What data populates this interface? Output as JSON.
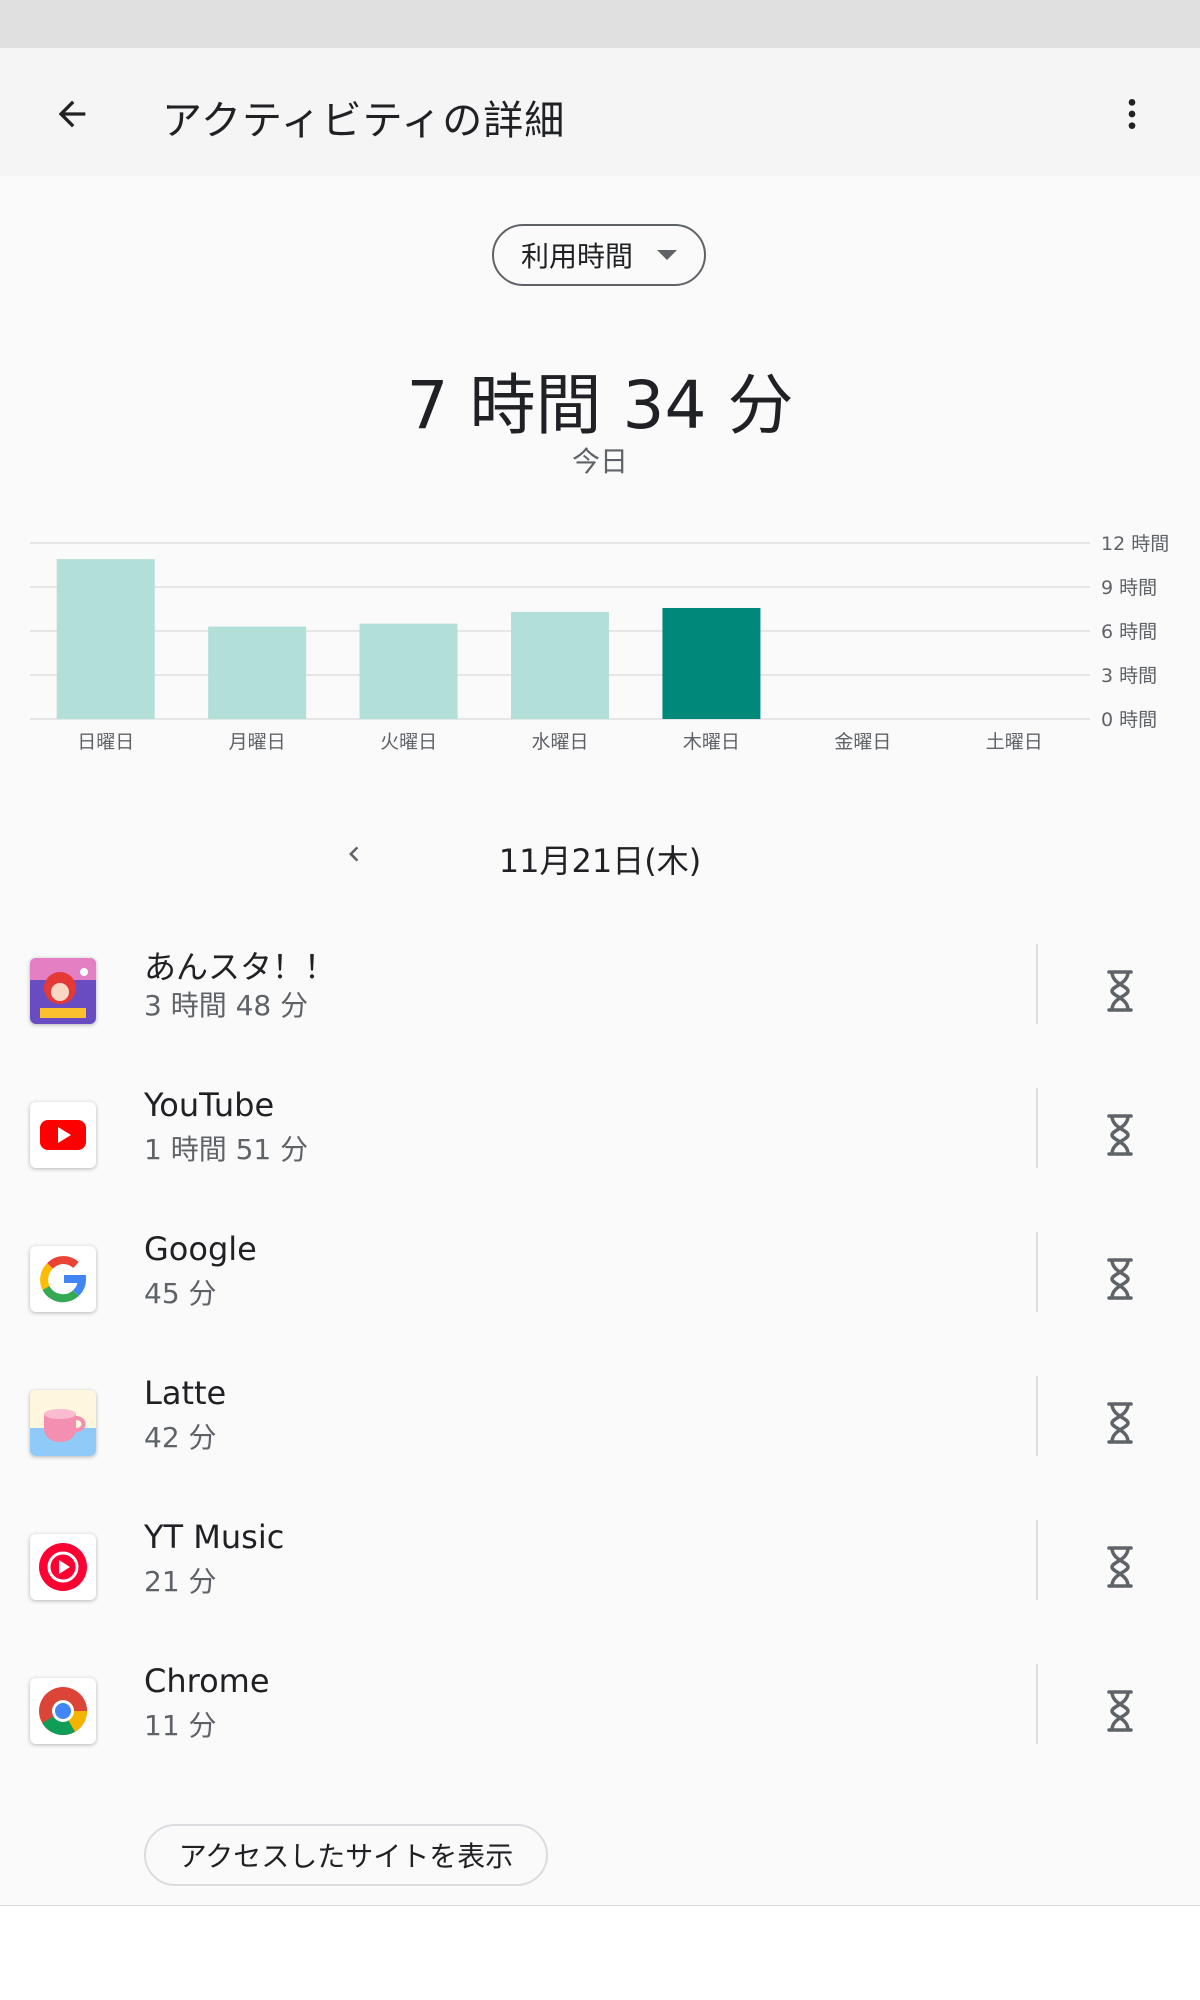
{
  "header": {
    "title": "アクティビティの詳細",
    "back_icon": "arrow-left-icon",
    "menu_icon": "more-vert-icon"
  },
  "selector": {
    "selected": "利用時間"
  },
  "summary": {
    "total": "7 時間 34 分",
    "period": "今日"
  },
  "chart_data": {
    "type": "bar",
    "categories": [
      "日曜日",
      "月曜日",
      "火曜日",
      "水曜日",
      "木曜日",
      "金曜日",
      "土曜日"
    ],
    "values": [
      10.9,
      6.3,
      6.5,
      7.3,
      7.57,
      0,
      0
    ],
    "highlight_index": 4,
    "ylim": [
      0,
      12
    ],
    "y_ticks": [
      0,
      3,
      6,
      9,
      12
    ],
    "y_tick_labels": [
      "0 時間",
      "3 時間",
      "6 時間",
      "9 時間",
      "12 時間"
    ],
    "colors": {
      "bar": "#b2dfd8",
      "highlight": "#00897b",
      "grid": "#e0e0e0"
    },
    "grid": true
  },
  "date_nav": {
    "date": "11月21日(木)",
    "prev_icon": "chevron-left-icon"
  },
  "apps": [
    {
      "name": "あんスタ！！",
      "time": "3 時間 48 分",
      "icon": "ensemble-stars-icon"
    },
    {
      "name": "YouTube",
      "time": "1 時間 51 分",
      "icon": "youtube-icon"
    },
    {
      "name": "Google",
      "time": "45 分",
      "icon": "google-icon"
    },
    {
      "name": "Latte",
      "time": "42 分",
      "icon": "latte-cup-icon"
    },
    {
      "name": "YT Music",
      "time": "21 分",
      "icon": "yt-music-icon"
    },
    {
      "name": "Chrome",
      "time": "11 分",
      "icon": "chrome-icon"
    }
  ],
  "timer_icon": "hourglass-icon",
  "footer": {
    "sites_button": "アクセスしたサイトを表示"
  }
}
